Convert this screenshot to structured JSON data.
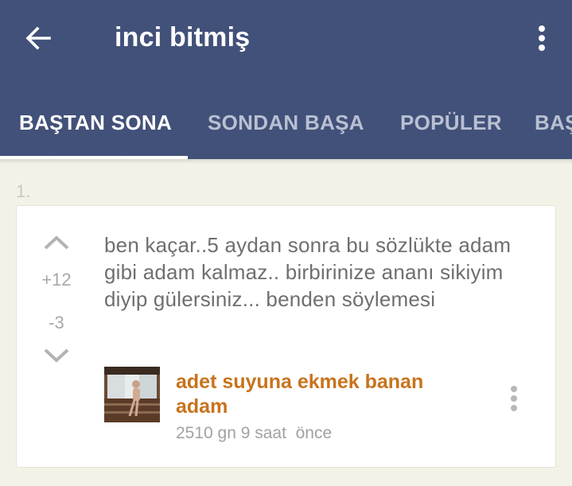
{
  "header": {
    "title": "inci bitmiş",
    "back_icon": "arrow-left-icon",
    "menu_icon": "more-vertical-icon",
    "background": "#425179"
  },
  "tabs": [
    {
      "label": "BAŞTAN SONA",
      "active": true
    },
    {
      "label": "SONDAN BAŞA",
      "active": false
    },
    {
      "label": "POPÜLER",
      "active": false
    },
    {
      "label": "BAŞ",
      "active": false
    }
  ],
  "entry": {
    "number": "1.",
    "upvotes": "+12",
    "downvotes": "-3",
    "text": "ben kaçar..5 aydan sonra bu sözlükte adam gibi adam kalmaz.. birbirinize ananı sikiyim diyip gülersiniz... benden söylemesi",
    "author": "adet suyuna ekmek banan adam",
    "date": "2510 gn 9 saat  önce",
    "author_color": "#c8731c",
    "upvote_icon": "chevron-up-icon",
    "downvote_icon": "chevron-down-icon",
    "entry_menu_icon": "more-vertical-icon"
  }
}
